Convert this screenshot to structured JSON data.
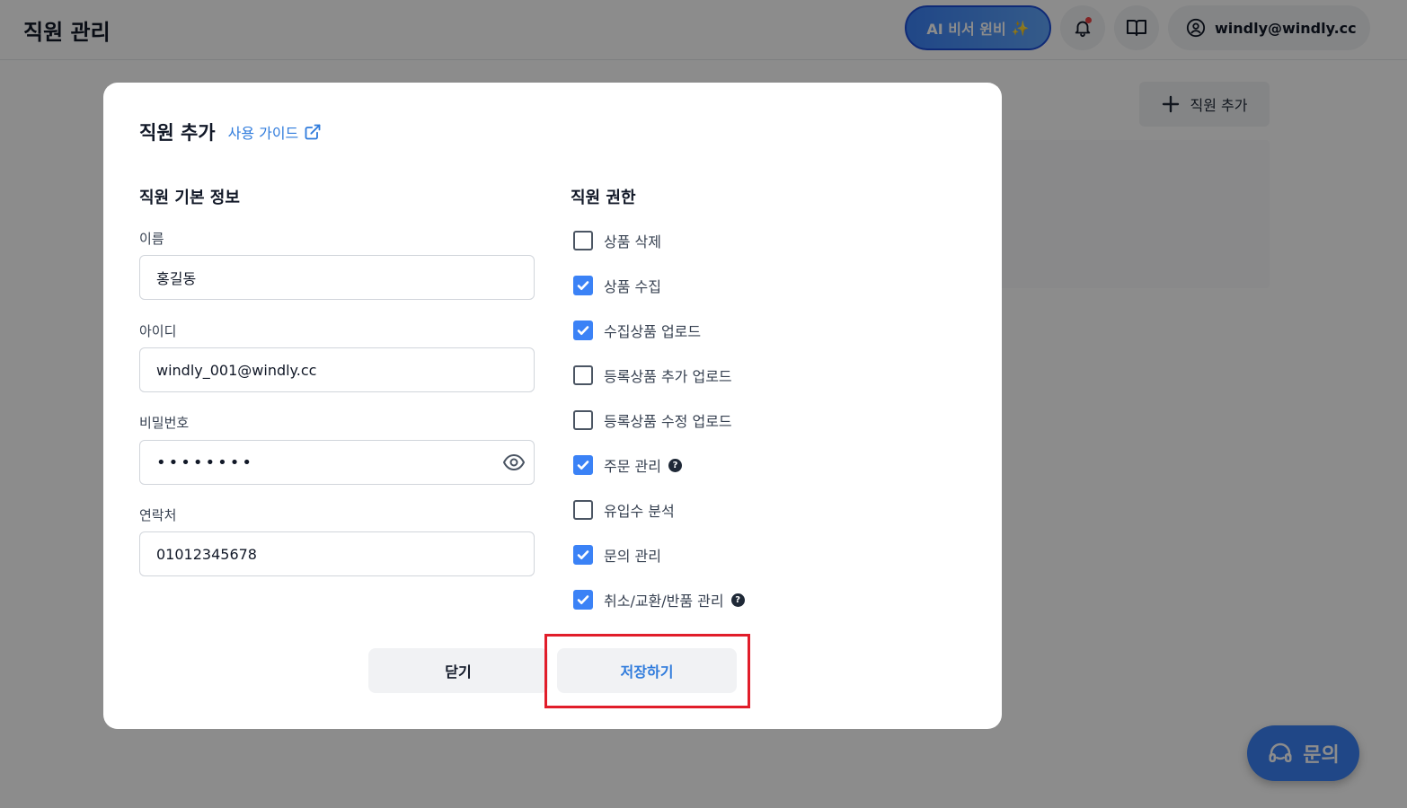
{
  "page": {
    "title": "직원 관리",
    "ai_button_label": "AI 비서 윈비",
    "account_label": "windly@windly.cc",
    "add_staff_label": "직원 추가",
    "inquiry_label": "문의"
  },
  "modal": {
    "title": "직원 추가",
    "guide_link": "사용 가이드",
    "basic_info_title": "직원 기본 정보",
    "fields": {
      "name": {
        "label": "이름",
        "value": "홍길동"
      },
      "id": {
        "label": "아이디",
        "value": "windly_001@windly.cc"
      },
      "password": {
        "label": "비밀번호",
        "value": "••••••••"
      },
      "contact": {
        "label": "연락처",
        "value": "01012345678"
      }
    },
    "permissions_title": "직원 권한",
    "permissions": [
      {
        "label": "상품 삭제",
        "checked": false,
        "help": false
      },
      {
        "label": "상품 수집",
        "checked": true,
        "help": false
      },
      {
        "label": "수집상품 업로드",
        "checked": true,
        "help": false
      },
      {
        "label": "등록상품 추가 업로드",
        "checked": false,
        "help": false
      },
      {
        "label": "등록상품 수정 업로드",
        "checked": false,
        "help": false
      },
      {
        "label": "주문 관리",
        "checked": true,
        "help": true
      },
      {
        "label": "유입수 분석",
        "checked": false,
        "help": false
      },
      {
        "label": "문의 관리",
        "checked": true,
        "help": false
      },
      {
        "label": "취소/교환/반품 관리",
        "checked": true,
        "help": true
      }
    ],
    "close_label": "닫기",
    "save_label": "저장하기"
  },
  "colors": {
    "accent": "#3b82f6",
    "link": "#2f7bdc",
    "highlight": "#e11d2a"
  }
}
